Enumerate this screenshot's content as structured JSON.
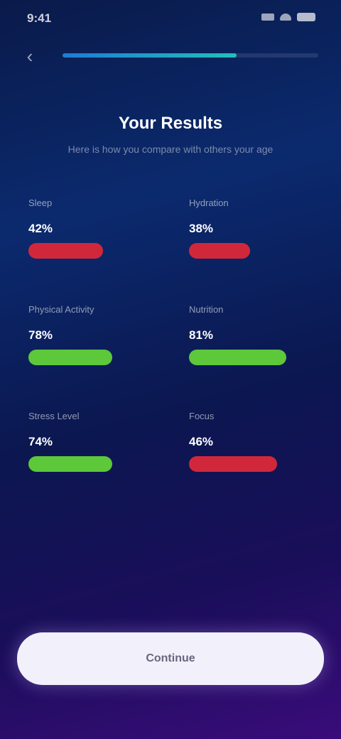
{
  "status_bar": {
    "time": "9:41",
    "icons": [
      "signal-icon",
      "wifi-icon",
      "battery-icon"
    ]
  },
  "header": {
    "back_icon": "chevron-left-icon",
    "progress_fraction": 0.68
  },
  "title": "Your Results",
  "subtitle": "Here is how you compare with others your age",
  "stats": [
    {
      "label": "Sleep",
      "value": "42%",
      "bar_fraction": 0.55,
      "status": "bad",
      "note": ""
    },
    {
      "label": "Hydration",
      "value": "38%",
      "bar_fraction": 0.45,
      "status": "bad",
      "note": ""
    },
    {
      "label": "Physical Activity",
      "value": "78%",
      "bar_fraction": 0.62,
      "status": "good",
      "note": ""
    },
    {
      "label": "Nutrition",
      "value": "81%",
      "bar_fraction": 0.72,
      "status": "good",
      "note": ""
    },
    {
      "label": "Stress Level",
      "value": "74%",
      "bar_fraction": 0.62,
      "status": "good",
      "note": ""
    },
    {
      "label": "Focus",
      "value": "46%",
      "bar_fraction": 0.65,
      "status": "bad",
      "note": ""
    }
  ],
  "colors": {
    "bad": "#d0283a",
    "good": "#5cc83a",
    "progress_start": "#1e7bd6",
    "progress_end": "#22c0b8"
  },
  "cta": {
    "label": "Continue"
  }
}
